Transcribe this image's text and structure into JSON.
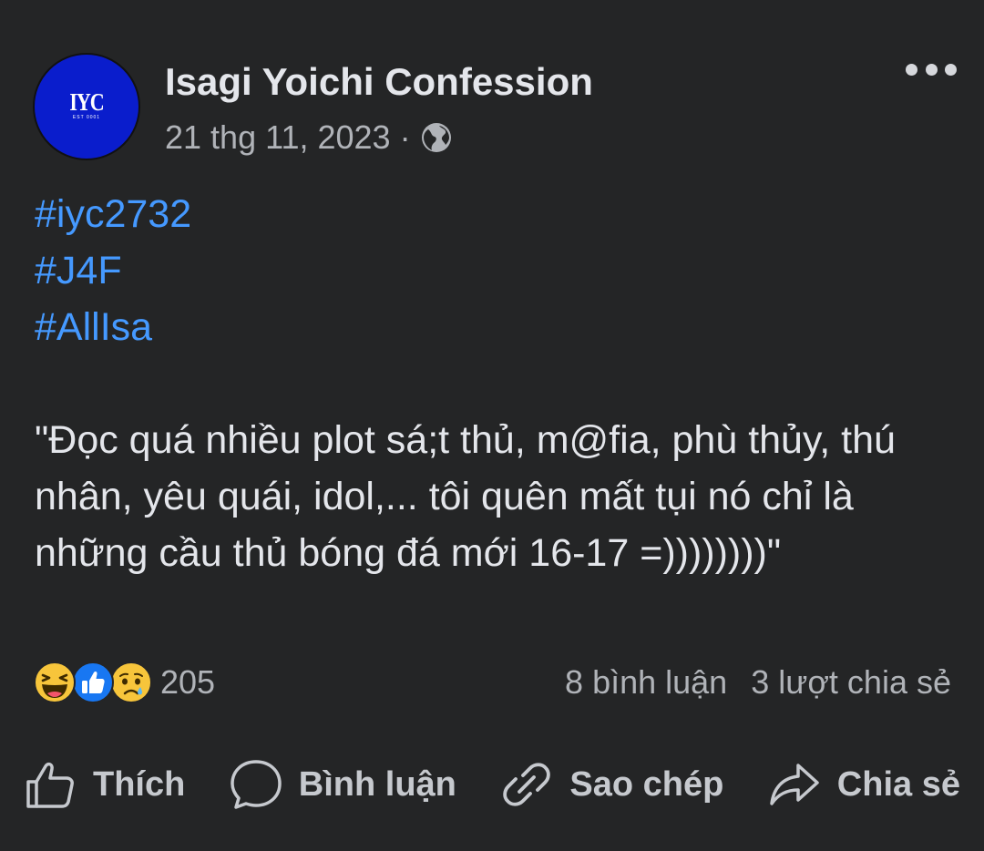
{
  "post": {
    "avatar": {
      "logo_text": "IYC",
      "logo_sub": "EST 0001"
    },
    "page_name": "Isagi Yoichi Confession",
    "date": "21 thg 11, 2023",
    "separator": "·",
    "privacy_icon": "globe-icon",
    "hashtags": [
      "#iyc2732",
      "#J4F",
      "#AllIsa"
    ],
    "body": "\"Đọc quá nhiều plot sá;t thủ, m@fia, phù thủy, thú nhân, yêu quái, idol,... tôi quên mất tụi nó chỉ là những cầu thủ bóng đá mới 16-17 =))))))))\""
  },
  "reactions": {
    "icons": [
      "haha-icon",
      "like-icon",
      "sad-icon"
    ],
    "count": "205",
    "comments": "8 bình luận",
    "shares": "3 lượt chia sẻ"
  },
  "actions": {
    "like": "Thích",
    "comment": "Bình luận",
    "copy": "Sao chép",
    "share": "Chia sẻ"
  },
  "colors": {
    "background": "#242526",
    "hashtag": "#4599ff",
    "secondary_text": "#b0b3b8",
    "avatar_bg": "#0a1dcc",
    "like_blue": "#1877f2",
    "emoji_yellow": "#f7c53b"
  }
}
